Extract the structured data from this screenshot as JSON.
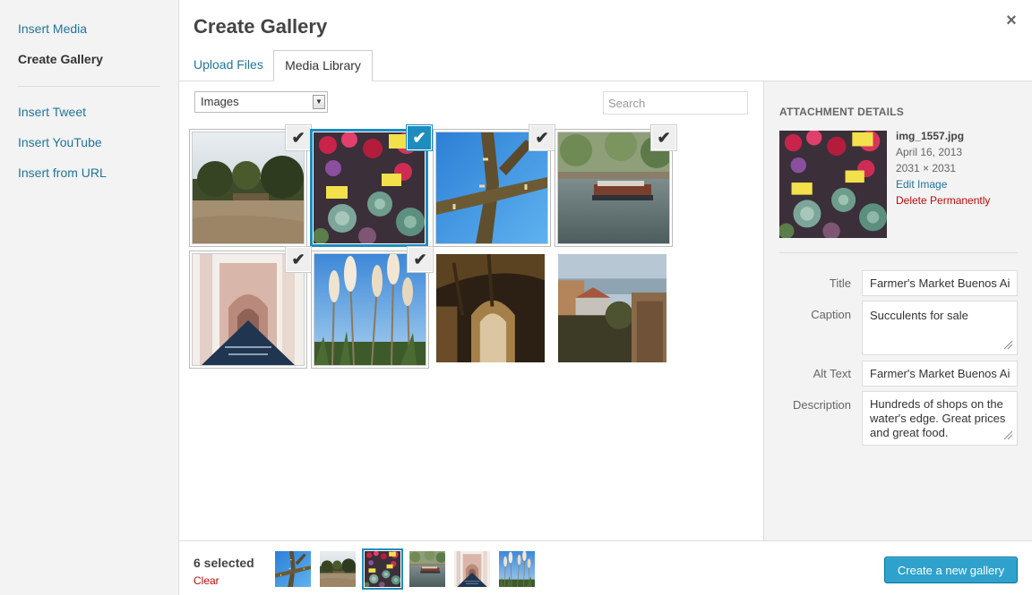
{
  "menu": {
    "items": [
      "Insert Media",
      "Create Gallery"
    ],
    "embeds": [
      "Insert Tweet",
      "Insert YouTube",
      "Insert from URL"
    ],
    "active_index": 1
  },
  "frame": {
    "title": "Create Gallery",
    "close_symbol": "×",
    "tabs": [
      "Upload Files",
      "Media Library"
    ]
  },
  "toolbar": {
    "filter_value": "Images",
    "filter_arrow": "▼",
    "search_placeholder": "Search"
  },
  "grid": {
    "check_symbol": "✔",
    "items": [
      {
        "name": "park-trees",
        "state": "selected"
      },
      {
        "name": "flower-market",
        "state": "details"
      },
      {
        "name": "cactus-sky",
        "state": "selected"
      },
      {
        "name": "river-boat",
        "state": "selected"
      },
      {
        "name": "cathedral",
        "state": "selected"
      },
      {
        "name": "pampas-grass",
        "state": "selected"
      },
      {
        "name": "stone-arch",
        "state": "unselected"
      },
      {
        "name": "coastal-village",
        "state": "unselected"
      }
    ]
  },
  "details": {
    "heading": "ATTACHMENT DETAILS",
    "filename": "img_1557.jpg",
    "date": "April 16, 2013",
    "dimensions": "2031 × 2031",
    "edit_label": "Edit Image",
    "delete_label": "Delete Permanently",
    "fields": {
      "title_label": "Title",
      "title_value": "Farmer's Market Buenos Aires",
      "caption_label": "Caption",
      "caption_value": "Succulents for sale",
      "alt_label": "Alt Text",
      "alt_value": "Farmer's Market Buenos Aires",
      "description_label": "Description",
      "description_value": "Hundreds of shops on the water's edge. Great prices and great food."
    }
  },
  "selection": {
    "count_label": "6 selected",
    "clear_label": "Clear",
    "thumbs": [
      "cactus-sky",
      "park-trees",
      "flower-market",
      "river-boat",
      "cathedral",
      "pampas-grass"
    ]
  },
  "actions": {
    "create_label": "Create a new gallery"
  },
  "colors": {
    "accent": "#1e8cbe",
    "link": "#21759b",
    "danger": "#bc0b0b",
    "button": "#2ea2cc"
  }
}
